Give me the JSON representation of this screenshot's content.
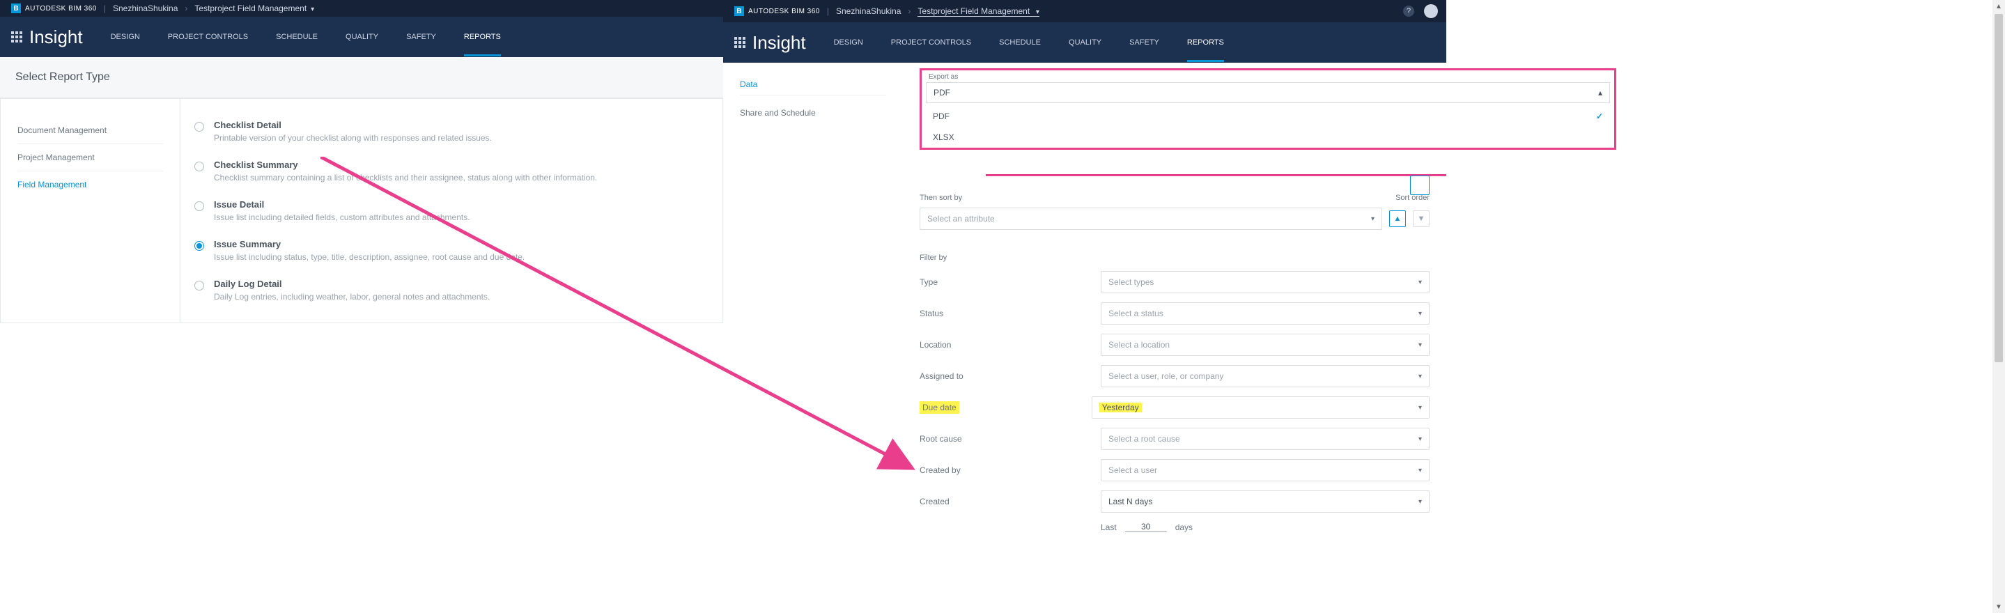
{
  "brand_product": "AUTODESK",
  "brand_suite": "BIM 360",
  "breadcrumb_user": "SnezhinaShukina",
  "breadcrumb_project": "Testproject Field Management",
  "insight_title": "Insight",
  "nav": {
    "design": "DESIGN",
    "project_controls": "PROJECT CONTROLS",
    "schedule": "SCHEDULE",
    "quality": "QUALITY",
    "safety": "SAFETY",
    "reports": "REPORTS"
  },
  "left": {
    "select_report": "Select Report Type",
    "sidebar": {
      "doc_mgmt": "Document Management",
      "proj_mgmt": "Project Management",
      "field_mgmt": "Field Management"
    },
    "options": [
      {
        "title": "Checklist Detail",
        "desc": "Printable version of your checklist along with responses and related issues."
      },
      {
        "title": "Checklist Summary",
        "desc": "Checklist summary containing a list of checklists and their assignee, status along with other information."
      },
      {
        "title": "Issue Detail",
        "desc": "Issue list including detailed fields, custom attributes and attachments."
      },
      {
        "title": "Issue Summary",
        "desc": "Issue list including status, type, title, description, assignee, root cause and due date."
      },
      {
        "title": "Daily Log Detail",
        "desc": "Daily Log entries, including weather, labor, general notes and attachments."
      }
    ]
  },
  "right": {
    "sidebar": {
      "data": "Data",
      "share": "Share and Schedule"
    },
    "export": {
      "label": "Export as",
      "selected": "PDF",
      "options": [
        "PDF",
        "XLSX"
      ]
    },
    "then_sort_by": "Then sort by",
    "sort_order": "Sort order",
    "sort_placeholder": "Select an attribute",
    "filter_by": "Filter by",
    "filters": {
      "type": {
        "label": "Type",
        "placeholder": "Select types"
      },
      "status": {
        "label": "Status",
        "placeholder": "Select a status"
      },
      "location": {
        "label": "Location",
        "placeholder": "Select a location"
      },
      "assigned_to": {
        "label": "Assigned to",
        "placeholder": "Select a user, role, or company"
      },
      "due_date": {
        "label": "Due date",
        "value": "Yesterday"
      },
      "root_cause": {
        "label": "Root cause",
        "placeholder": "Select a root cause"
      },
      "created_by": {
        "label": "Created by",
        "placeholder": "Select a user"
      },
      "created": {
        "label": "Created",
        "value": "Last N days"
      }
    },
    "lastn": {
      "prefix": "Last",
      "value": "30",
      "suffix": "days"
    }
  }
}
